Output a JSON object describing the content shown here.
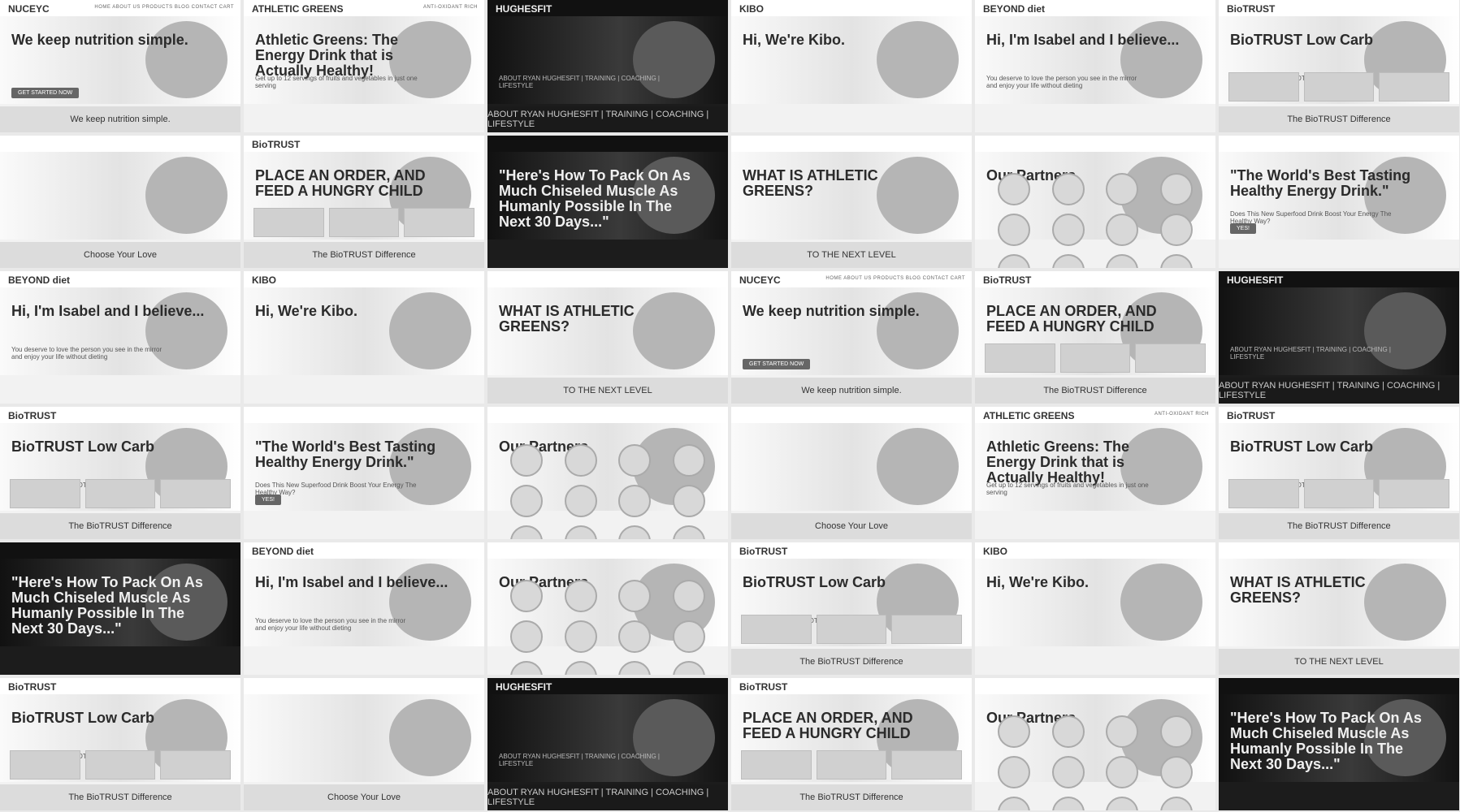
{
  "page": {
    "background": "#e9e9e9"
  },
  "tiles": [
    {
      "id": "nutrition-hero",
      "theme": "light",
      "brand": "NUCEYC",
      "menu": "HOME ABOUT US PRODUCTS BLOG CONTACT CART",
      "headline": "We keep nutrition simple.",
      "subline": "",
      "cta": "GET STARTED NOW",
      "bottom": "We keep nutrition simple."
    },
    {
      "id": "athletic-greens",
      "theme": "light",
      "brand": "ATHLETIC GREENS",
      "menu": "ANTI-OXIDANT RICH",
      "headline": "Athletic Greens: The Energy Drink that is Actually Healthy!",
      "subline": "Get up to 12 servings of fruits and vegetables in just one serving",
      "cta": "",
      "bottom": ""
    },
    {
      "id": "hughesfit-face",
      "theme": "dark",
      "brand": "HUGHESFIT",
      "menu": "",
      "headline": "",
      "subline": "ABOUT RYAN HUGHESFIT | TRAINING | COACHING | LIFESTYLE",
      "cta": "",
      "bottom": "ABOUT RYAN HUGHESFIT | TRAINING | COACHING | LIFESTYLE"
    },
    {
      "id": "kibo-hi",
      "theme": "light",
      "brand": "KIBO",
      "menu": "",
      "headline": "Hi, We're Kibo.",
      "subline": "",
      "cta": "",
      "bottom": ""
    },
    {
      "id": "beyond-diet",
      "theme": "light",
      "brand": "BEYOND diet",
      "menu": "",
      "headline": "Hi, I'm Isabel and I believe...",
      "subline": "You deserve to love the person you see in the mirror and enjoy your life without dieting",
      "cta": "",
      "bottom": ""
    },
    {
      "id": "biotrust-lowcarb",
      "theme": "light",
      "brand": "BioTRUST",
      "menu": "",
      "headline": "BioTRUST Low Carb",
      "subline": "LOW-CARB FOUR-PROTEIN BLEND",
      "cta": "",
      "bottom": "The BioTRUST Difference"
    },
    {
      "id": "choose-your-love",
      "theme": "light",
      "brand": "",
      "menu": "",
      "headline": "",
      "subline": "",
      "cta": "",
      "bottom": "Choose Your Love"
    },
    {
      "id": "biotrust-order",
      "theme": "light",
      "brand": "BioTRUST",
      "menu": "",
      "headline": "PLACE AN ORDER, AND FEED A HUNGRY CHILD",
      "subline": "",
      "cta": "",
      "bottom": "The BioTRUST Difference"
    },
    {
      "id": "hoodie-hero",
      "theme": "dark",
      "brand": "",
      "menu": "",
      "headline": "\"Here's How To Pack On As Much Chiseled Muscle As Humanly Possible In The Next 30 Days...\"",
      "subline": "",
      "cta": "",
      "bottom": ""
    },
    {
      "id": "athletic-testimonials",
      "theme": "light",
      "brand": "",
      "menu": "",
      "headline": "WHAT IS ATHLETIC GREENS?",
      "subline": "",
      "cta": "",
      "bottom": "TO THE NEXT LEVEL"
    },
    {
      "id": "partners",
      "theme": "light",
      "brand": "",
      "menu": "",
      "headline": "Our Partners",
      "subline": "",
      "cta": "",
      "bottom": ""
    },
    {
      "id": "superfood",
      "theme": "light",
      "brand": "",
      "menu": "",
      "headline": "\"The World's Best Tasting Healthy Energy Drink.\"",
      "subline": "Does This New Superfood Drink Boost Your Energy The Healthy Way?",
      "cta": "YES!",
      "bottom": ""
    }
  ]
}
